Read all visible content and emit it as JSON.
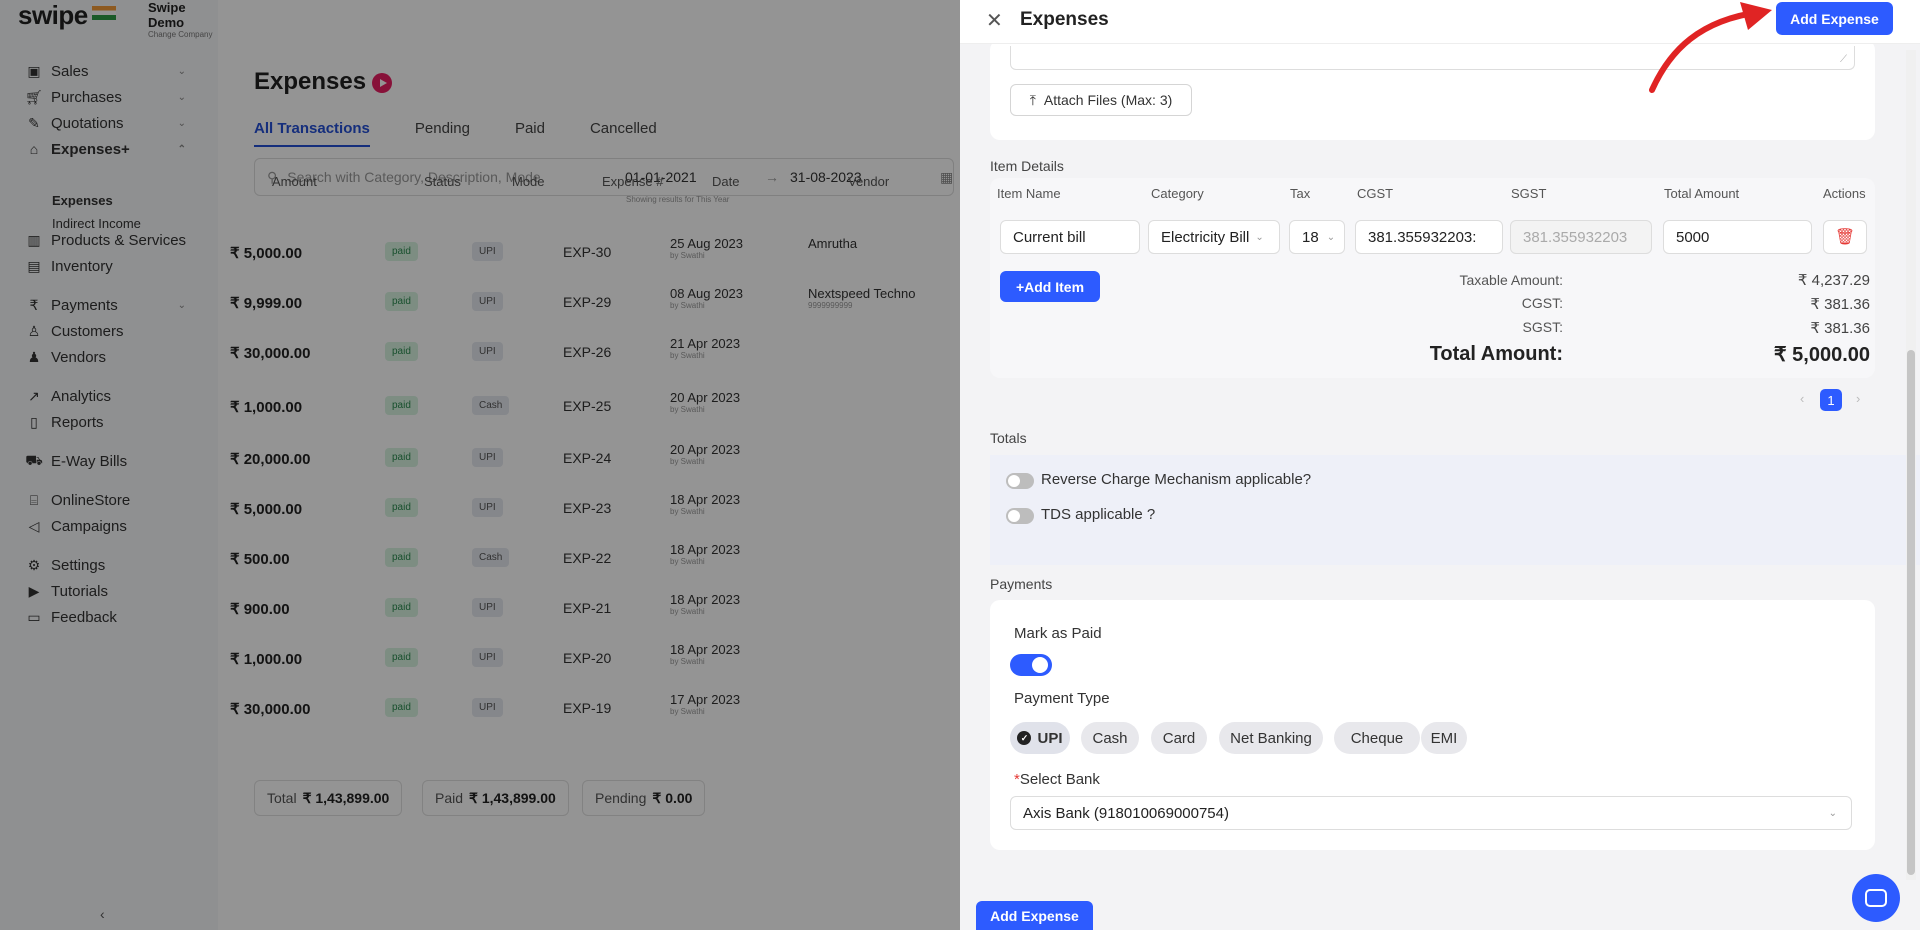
{
  "brand": {
    "logo": "swipe",
    "company": "Swipe Demo",
    "company_sub": "Change Company"
  },
  "sidebar": {
    "items": [
      {
        "label": "Sales",
        "icon": "sales-icon",
        "chev": "⌄"
      },
      {
        "label": "Purchases",
        "icon": "cart-icon",
        "chev": "⌄"
      },
      {
        "label": "Quotations",
        "icon": "pen-icon",
        "chev": "⌄"
      },
      {
        "label": "Expenses+",
        "icon": "tag-icon",
        "chev": "⌃"
      },
      {
        "label": "Products & Services",
        "icon": "barcode-icon"
      },
      {
        "label": "Inventory",
        "icon": "warehouse-icon"
      },
      {
        "label": "Payments",
        "icon": "rupee-icon",
        "chev": "⌄"
      },
      {
        "label": "Customers",
        "icon": "user-icon"
      },
      {
        "label": "Vendors",
        "icon": "users-icon"
      },
      {
        "label": "Analytics",
        "icon": "chart-icon"
      },
      {
        "label": "Reports",
        "icon": "report-icon"
      },
      {
        "label": "E-Way Bills",
        "icon": "truck-icon"
      },
      {
        "label": "OnlineStore",
        "icon": "store-icon"
      },
      {
        "label": "Campaigns",
        "icon": "megaphone-icon"
      },
      {
        "label": "Settings",
        "icon": "gear-icon"
      },
      {
        "label": "Tutorials",
        "icon": "youtube-icon"
      },
      {
        "label": "Feedback",
        "icon": "feedback-icon"
      }
    ],
    "sub_items": [
      "Expenses",
      "Indirect Income"
    ],
    "collapse": "‹"
  },
  "main": {
    "title": "Expenses",
    "tabs": [
      "All Transactions",
      "Pending",
      "Paid",
      "Cancelled"
    ],
    "search_placeholder": "Search with Category, Description, Mode",
    "date_from": "01-01-2021",
    "date_to": "31-08-2023",
    "date_sep": "→",
    "date_hint": "Showing results for This Year",
    "columns": [
      "Amount",
      "Status",
      "Mode",
      "Expense #",
      "Date",
      "Vendor"
    ],
    "rows": [
      {
        "amount": "₹ 5,000.00",
        "status": "paid",
        "mode": "UPI",
        "exp": "EXP-30",
        "date": "25 Aug 2023",
        "by": "by Swathi",
        "vendor": "Amrutha",
        "vendor_sub": ""
      },
      {
        "amount": "₹ 9,999.00",
        "status": "paid",
        "mode": "UPI",
        "exp": "EXP-29",
        "date": "08 Aug 2023",
        "by": "by Swathi",
        "vendor": "Nextspeed Techno",
        "vendor_sub": "9999999999"
      },
      {
        "amount": "₹ 30,000.00",
        "status": "paid",
        "mode": "UPI",
        "exp": "EXP-26",
        "date": "21 Apr 2023",
        "by": "by Swathi",
        "vendor": "",
        "vendor_sub": ""
      },
      {
        "amount": "₹ 1,000.00",
        "status": "paid",
        "mode": "Cash",
        "exp": "EXP-25",
        "date": "20 Apr 2023",
        "by": "by Swathi",
        "vendor": "",
        "vendor_sub": ""
      },
      {
        "amount": "₹ 20,000.00",
        "status": "paid",
        "mode": "UPI",
        "exp": "EXP-24",
        "date": "20 Apr 2023",
        "by": "by Swathi",
        "vendor": "",
        "vendor_sub": ""
      },
      {
        "amount": "₹ 5,000.00",
        "status": "paid",
        "mode": "UPI",
        "exp": "EXP-23",
        "date": "18 Apr 2023",
        "by": "by Swathi",
        "vendor": "",
        "vendor_sub": ""
      },
      {
        "amount": "₹ 500.00",
        "status": "paid",
        "mode": "Cash",
        "exp": "EXP-22",
        "date": "18 Apr 2023",
        "by": "by Swathi",
        "vendor": "",
        "vendor_sub": ""
      },
      {
        "amount": "₹ 900.00",
        "status": "paid",
        "mode": "UPI",
        "exp": "EXP-21",
        "date": "18 Apr 2023",
        "by": "by Swathi",
        "vendor": "",
        "vendor_sub": ""
      },
      {
        "amount": "₹ 1,000.00",
        "status": "paid",
        "mode": "UPI",
        "exp": "EXP-20",
        "date": "18 Apr 2023",
        "by": "by Swathi",
        "vendor": "",
        "vendor_sub": ""
      },
      {
        "amount": "₹ 30,000.00",
        "status": "paid",
        "mode": "UPI",
        "exp": "EXP-19",
        "date": "17 Apr 2023",
        "by": "by Swathi",
        "vendor": "",
        "vendor_sub": ""
      }
    ],
    "summary": [
      {
        "label": "Total",
        "value": "₹ 1,43,899.00"
      },
      {
        "label": "Paid",
        "value": "₹ 1,43,899.00"
      },
      {
        "label": "Pending",
        "value": "₹ 0.00"
      }
    ]
  },
  "panel": {
    "title": "Expenses",
    "close": "✕",
    "add_button": "Add Expense",
    "attach": "Attach Files (Max: 3)",
    "item_details_label": "Item Details",
    "item_columns": [
      "Item Name",
      "Category",
      "Tax",
      "CGST",
      "SGST",
      "Total Amount",
      "Actions"
    ],
    "item": {
      "name": "Current bill",
      "category": "Electricity Bill",
      "tax": "18",
      "cgst": "381.355932203:",
      "sgst": "381.355932203",
      "total": "5000"
    },
    "add_item": "+Add Item",
    "summary": [
      {
        "label": "Taxable Amount:",
        "value": "₹ 4,237.29"
      },
      {
        "label": "CGST:",
        "value": "₹ 381.36"
      },
      {
        "label": "SGST:",
        "value": "₹ 381.36"
      },
      {
        "label": "Total Amount:",
        "value": "₹ 5,000.00"
      }
    ],
    "page": "1",
    "totals_label": "Totals",
    "rcm": "Reverse Charge Mechanism applicable?",
    "tds": "TDS applicable ?",
    "payments_label": "Payments",
    "mark_paid": "Mark as Paid",
    "mark_paid_on": true,
    "payment_type_label": "Payment Type",
    "payment_types": [
      "UPI",
      "Cash",
      "Card",
      "Net Banking",
      "Cheque",
      "EMI"
    ],
    "payment_selected": "UPI",
    "bank_label": "Select Bank",
    "bank_required": "*",
    "bank_value": "Axis Bank (918010069000754)",
    "footer_add": "Add Expense"
  },
  "colors": {
    "accent": "#2d5bff",
    "annotation_arrow": "#e02424",
    "delete": "#e53935"
  }
}
